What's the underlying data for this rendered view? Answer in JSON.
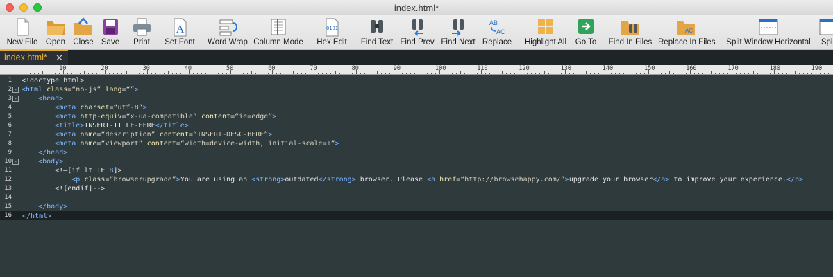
{
  "window": {
    "title": "index.html*"
  },
  "toolbar": {
    "buttons": [
      {
        "id": "new-file",
        "label": "New File"
      },
      {
        "id": "open",
        "label": "Open"
      },
      {
        "id": "close",
        "label": "Close"
      },
      {
        "id": "save",
        "label": "Save"
      },
      {
        "id": "print",
        "label": "Print"
      },
      {
        "id": "set-font",
        "label": "Set Font"
      },
      {
        "id": "word-wrap",
        "label": "Word Wrap"
      },
      {
        "id": "column-mode",
        "label": "Column Mode"
      },
      {
        "id": "hex-edit",
        "label": "Hex Edit"
      },
      {
        "id": "find-text",
        "label": "Find Text"
      },
      {
        "id": "find-prev",
        "label": "Find Prev"
      },
      {
        "id": "find-next",
        "label": "Find Next"
      },
      {
        "id": "replace",
        "label": "Replace"
      },
      {
        "id": "highlight-all",
        "label": "Highlight All"
      },
      {
        "id": "go-to",
        "label": "Go To"
      },
      {
        "id": "find-in-files",
        "label": "Find In Files"
      },
      {
        "id": "replace-in-files",
        "label": "Replace In Files"
      },
      {
        "id": "split-window-horizontal",
        "label": "Split Window Horizontal"
      },
      {
        "id": "split-window-vertical",
        "label": "Split"
      }
    ],
    "icon_glyphs": {
      "hex": "0101",
      "replace_top": "AB",
      "replace_bottom": "AC"
    }
  },
  "tabs": [
    {
      "label": "index.html*",
      "close": "✕"
    }
  ],
  "ruler": {
    "labels": [
      "10",
      "20",
      "30",
      "40",
      "50",
      "60",
      "70",
      "80",
      "90",
      "100",
      "110",
      "120",
      "130",
      "140",
      "150",
      "160",
      "170",
      "180",
      "190"
    ]
  },
  "editor": {
    "current_line": 16,
    "lines": [
      {
        "n": "1",
        "fold": "",
        "html": "&lt;!doctype html&gt;"
      },
      {
        "n": "2",
        "fold": "-",
        "html": "<span class='t'>&lt;html</span> <span class='a'>class</span>=<span class='s'>“no-js”</span> <span class='a'>lang</span>=<span class='s'>“”</span><span class='t'>&gt;</span>"
      },
      {
        "n": "3",
        "fold": "-",
        "html": "    <span class='t'>&lt;head&gt;</span>"
      },
      {
        "n": "4",
        "fold": "",
        "html": "        <span class='t'>&lt;meta</span> <span class='a'>charset</span>=<span class='s'>“utf-8”</span><span class='t'>&gt;</span>"
      },
      {
        "n": "5",
        "fold": "",
        "html": "        <span class='t'>&lt;meta</span> <span class='a'>http-equiv</span>=<span class='s'>“x-ua-compatible”</span> <span class='a'>content</span>=<span class='s'>“ie=edge”</span><span class='t'>&gt;</span>"
      },
      {
        "n": "6",
        "fold": "",
        "html": "        <span class='t'>&lt;title&gt;</span>INSERT-TITLE-HERE<span class='t'>&lt;/title&gt;</span>"
      },
      {
        "n": "7",
        "fold": "",
        "html": "        <span class='t'>&lt;meta</span> <span class='a'>name</span>=<span class='s'>“description”</span> <span class='a'>content</span>=<span class='s'>“INSERT-DESC-HERE”</span><span class='t'>&gt;</span>"
      },
      {
        "n": "8",
        "fold": "",
        "html": "        <span class='t'>&lt;meta</span> <span class='a'>name</span>=<span class='s'>“viewport”</span> <span class='a'>content</span>=<span class='s'>“width=device-width, initial-scale=<span class='t'>1</span>”</span><span class='t'>&gt;</span>"
      },
      {
        "n": "9",
        "fold": "",
        "html": "    <span class='t'>&lt;/head&gt;</span>"
      },
      {
        "n": "10",
        "fold": "-",
        "html": "    <span class='t'>&lt;body&gt;</span>"
      },
      {
        "n": "11",
        "fold": "",
        "html": "        <span class='cm'>&lt;!—[if lt IE <span class='t'>8</span>]&gt;</span>"
      },
      {
        "n": "12",
        "fold": "",
        "html": "            <span class='t'>&lt;p</span> <span class='a'>class</span>=<span class='s'>“browserupgrade”</span><span class='t'>&gt;</span>You are using an <span class='t'>&lt;strong&gt;</span>outdated<span class='t'>&lt;/strong&gt;</span> browser. Please <span class='t'>&lt;a</span> <span class='a'>href</span>=<span class='s'>“http://browsehappy.com/”</span><span class='t'>&gt;</span>upgrade your browser<span class='t'>&lt;/a&gt;</span> to improve your experience.<span class='t'>&lt;/p&gt;</span>"
      },
      {
        "n": "13",
        "fold": "",
        "html": "        <span class='cm'>&lt;![endif]--&gt;</span>"
      },
      {
        "n": "14",
        "fold": "",
        "html": ""
      },
      {
        "n": "15",
        "fold": "",
        "html": "    <span class='t'>&lt;/body&gt;</span>"
      },
      {
        "n": "16",
        "fold": "",
        "html": "<span class='caret'></span><span class='t'>&lt;/html&gt;</span>"
      }
    ]
  },
  "colors": {
    "editor_bg": "#2f3a3d",
    "tab_accent": "#e8a92b",
    "tag": "#7fb8ff",
    "attr": "#f0e6b4"
  }
}
